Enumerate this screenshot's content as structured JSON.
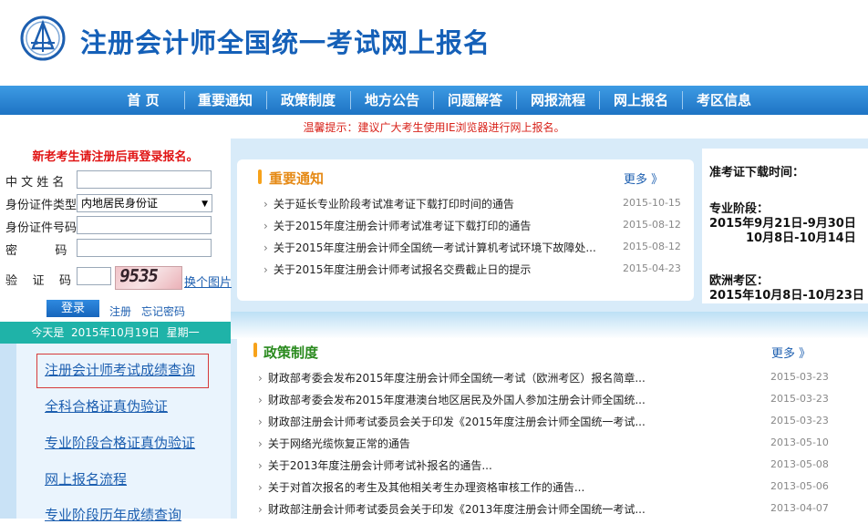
{
  "header": {
    "title": "注册会计师全国统一考试网上报名",
    "logo_icon": "abacus-emblem-icon"
  },
  "nav": {
    "items": [
      {
        "label": "首  页"
      },
      {
        "label": "重要通知"
      },
      {
        "label": "政策制度"
      },
      {
        "label": "地方公告"
      },
      {
        "label": "问题解答"
      },
      {
        "label": "网报流程"
      },
      {
        "label": "网上报名"
      },
      {
        "label": "考区信息"
      }
    ]
  },
  "tip": "温馨提示：建议广大考生使用IE浏览器进行网上报名。",
  "login": {
    "hint": "新老考生请注册后再登录报名。",
    "name_label": "中 文 姓 名",
    "idtype_label": "身份证件类型",
    "idtype_value": "内地居民身份证",
    "idno_label": "身份证件号码",
    "password_label": "密          码",
    "captcha_label": "验    证    码",
    "captcha_code": "9535",
    "change_image": "换个图片",
    "login_button": "登录",
    "register_link": "注册",
    "forgot_link": "忘记密码"
  },
  "datebar": "今天是  2015年10月19日  星期一",
  "left_menu": [
    "注册会计师考试成绩查询",
    "全科合格证真伪验证",
    "专业阶段合格证真伪验证",
    "网上报名流程",
    "专业阶段历年成绩查询"
  ],
  "notice": {
    "title": "重要通知",
    "more": "更多 》",
    "items": [
      {
        "text": "关于延长专业阶段考试准考证下载打印时间的通告",
        "date": "2015-10-15"
      },
      {
        "text": "关于2015年度注册会计师考试准考证下载打印的通告",
        "date": "2015-08-12"
      },
      {
        "text": "关于2015年度注册会计师全国统一考试计算机考试环境下故障处...",
        "date": "2015-08-12"
      },
      {
        "text": "关于2015年度注册会计师考试报名交费截止日的提示",
        "date": "2015-04-23"
      }
    ]
  },
  "exam_info": {
    "title": "准考证下载时间：",
    "pro_label": "专业阶段：",
    "pro_line1": "2015年9月21日-9月30日",
    "pro_line2": "10月8日-10月14日",
    "eu_label": "欧洲考区：",
    "eu_line1": "2015年10月8日-10月23日"
  },
  "policy": {
    "title": "政策制度",
    "more": "更多 》",
    "items": [
      {
        "text": "财政部考委会发布2015年度注册会计师全国统一考试（欧洲考区）报名简章...",
        "date": "2015-03-23"
      },
      {
        "text": "财政部考委会发布2015年度港澳台地区居民及外国人参加注册会计师全国统...",
        "date": "2015-03-23"
      },
      {
        "text": "财政部注册会计师考试委员会关于印发《2015年度注册会计师全国统一考试...",
        "date": "2015-03-23"
      },
      {
        "text": "关于网络光缆恢复正常的通告",
        "date": "2013-05-10"
      },
      {
        "text": "关于2013年度注册会计师考试补报名的通告...",
        "date": "2013-05-08"
      },
      {
        "text": "关于对首次报名的考生及其他相关考生办理资格审核工作的通告...",
        "date": "2013-05-06"
      },
      {
        "text": "财政部注册会计师考试委员会关于印发《2013年度注册会计师全国统一考试...",
        "date": "2013-04-07"
      }
    ]
  },
  "colors": {
    "brand_blue": "#1560b8",
    "nav_blue": "#1e73c4",
    "warning_red": "#d8221a",
    "notice_orange": "#e58914",
    "policy_green": "#2a8a1e",
    "teal": "#1fb3a8"
  }
}
